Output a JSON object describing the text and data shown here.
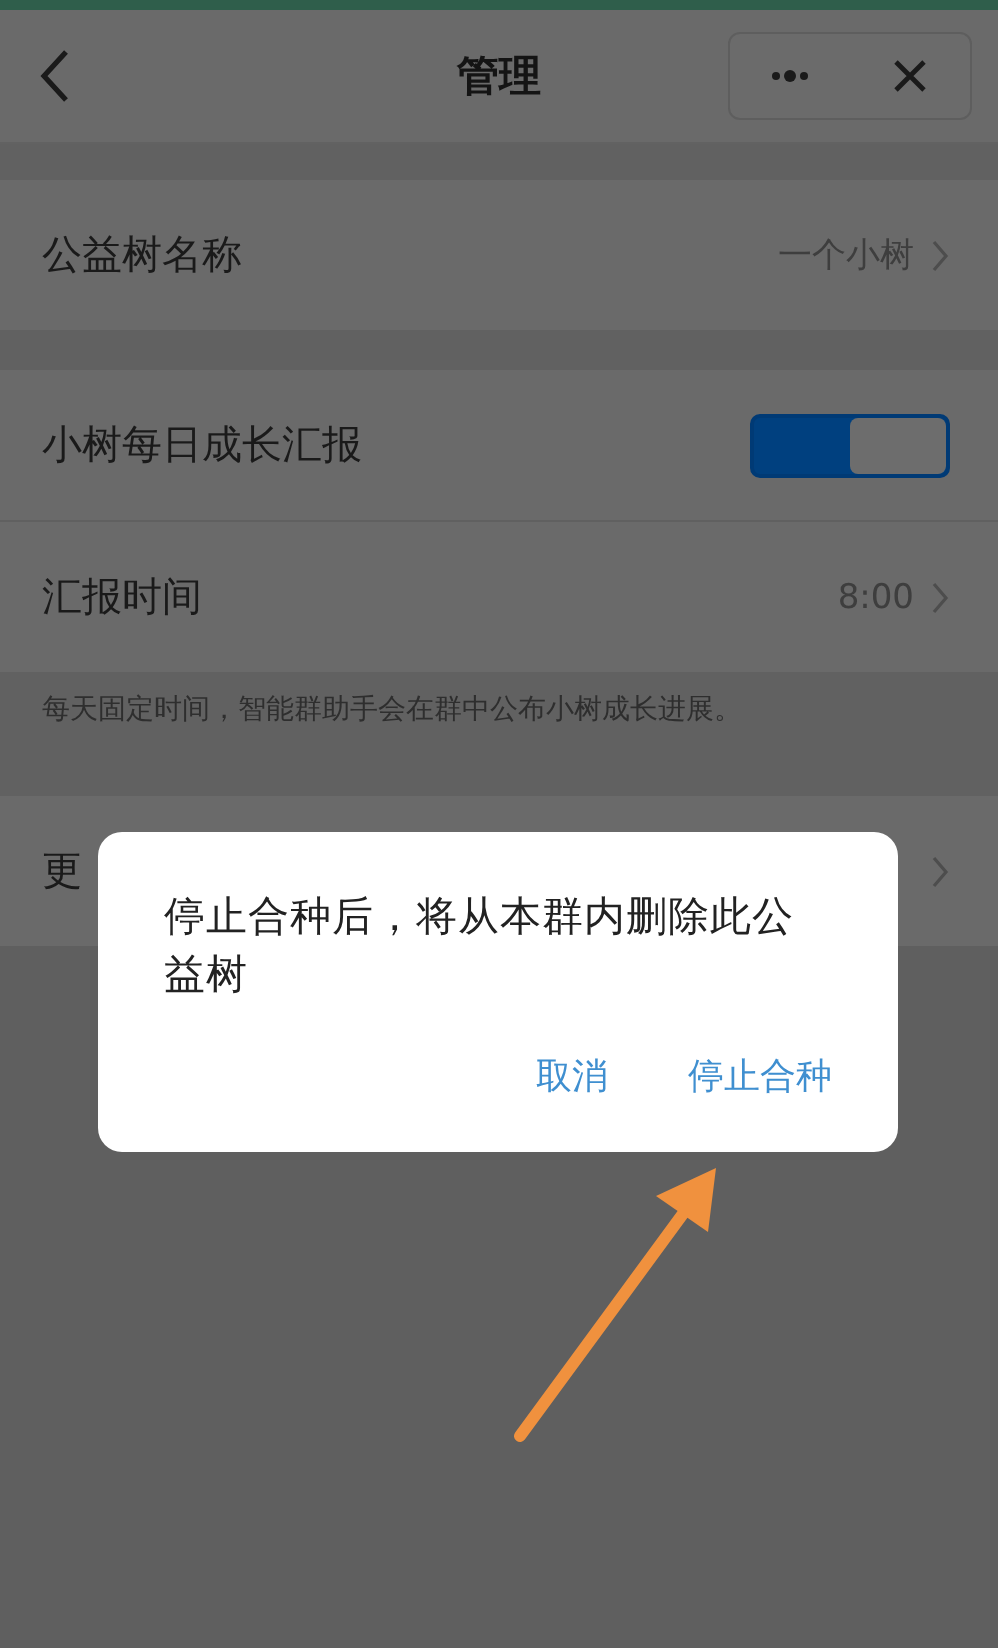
{
  "header": {
    "title": "管理"
  },
  "sections": [
    {
      "rows": [
        {
          "kind": "value",
          "label": "公益树名称",
          "value": "一个小树"
        }
      ]
    },
    {
      "rows": [
        {
          "kind": "switch",
          "label": "小树每日成长汇报",
          "on": true
        },
        {
          "kind": "value",
          "label": "汇报时间",
          "value": "8:00"
        }
      ],
      "note": "每天固定时间，智能群助手会在群中公布小树成长进展。"
    },
    {
      "rows": [
        {
          "kind": "link",
          "label": "更"
        }
      ]
    }
  ],
  "dialog": {
    "message": "停止合种后，将从本群内删除此公益树",
    "buttons": [
      "取消",
      "停止合种"
    ]
  }
}
